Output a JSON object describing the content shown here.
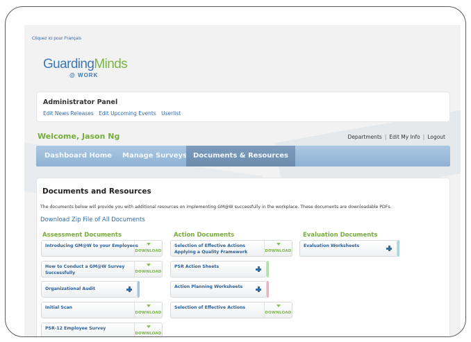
{
  "language_link": "Cliquez ici pour Français",
  "logo": {
    "main_blue": "Guarding",
    "main_green": "Minds",
    "sub": "@ WORK"
  },
  "admin_panel": {
    "title": "Administrator Panel",
    "links": [
      "Edit News Releases",
      "Edit Upcoming Events",
      "Userlist"
    ]
  },
  "welcome": "Welcome, Jason Ng",
  "top_links": [
    "Departments",
    "Edit My Info",
    "Logout"
  ],
  "nav": {
    "tabs": [
      "Dashboard Home",
      "Manage Surveys",
      "Documents & Resources"
    ],
    "active": "Documents & Resources"
  },
  "content": {
    "title": "Documents and Resources",
    "description": "The documents below will provide you with additional resources on implementing GM@W successfully in the workplace. These documents are downloadable PDFs.",
    "zip_link": "Download Zip File of All Documents"
  },
  "download_label": "DOWNLOAD",
  "columns": [
    {
      "title": "Assessment Documents",
      "items": [
        {
          "label": "Introducing GM@W to your Employees",
          "action": "download"
        },
        {
          "label": "How to Conduct a GM@W Survey Successfully",
          "action": "download"
        },
        {
          "label": "Organizational Audit",
          "action": "expand",
          "accent": "#a9c4dc"
        },
        {
          "label": "Initial Scan",
          "action": "download"
        },
        {
          "label": "PSR-12 Employee Survey",
          "action": "download"
        }
      ]
    },
    {
      "title": "Action Documents",
      "items": [
        {
          "label": "Selection of Effective Actions Applying a Quality Framework",
          "action": "download"
        },
        {
          "label": "PSR Action Sheets",
          "action": "expand",
          "accent": "#b5dbb0"
        },
        {
          "label": "Action Planning Worksheets",
          "action": "expand",
          "accent": "#e3b7bd"
        },
        {
          "label": "Selection of Effective Actions",
          "action": "download"
        }
      ]
    },
    {
      "title": "Evaluation Documents",
      "items": [
        {
          "label": "Evaluation Worksheets",
          "action": "expand",
          "accent": "#a9d7dc"
        }
      ]
    }
  ],
  "colors": {
    "brand_blue": "#3d78b4",
    "brand_green": "#7ab449",
    "nav_bar": "#9dbcdb",
    "link": "#3568a8"
  }
}
